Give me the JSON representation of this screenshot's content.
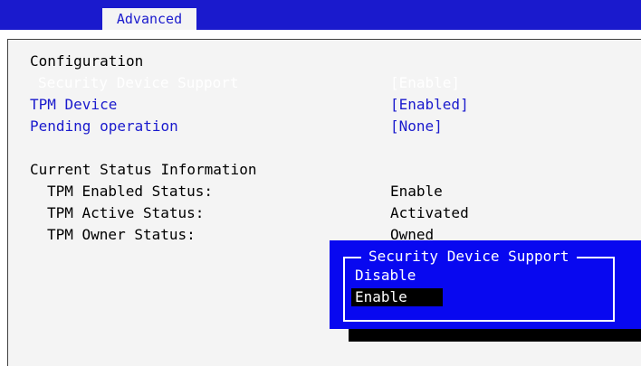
{
  "header": {
    "tab_label": "Advanced"
  },
  "main": {
    "section_configuration": "Configuration",
    "security_device_support": {
      "label": "Security Device Support",
      "value": "[Enable]"
    },
    "tpm_device": {
      "label": "TPM Device",
      "value": "[Enabled]"
    },
    "pending_operation": {
      "label": "Pending operation",
      "value": "[None]"
    },
    "section_status": "Current Status Information",
    "status_items": [
      {
        "label": "TPM Enabled Status:",
        "value": "Enable"
      },
      {
        "label": "TPM Active Status:",
        "value": "Activated"
      },
      {
        "label": "TPM Owner Status:",
        "value": "Owned"
      }
    ]
  },
  "popup": {
    "title": "Security Device Support",
    "options": [
      "Disable",
      "Enable"
    ],
    "selected": "Enable"
  },
  "colors": {
    "header_blue": "#1a1acd",
    "popup_blue": "#0808f0",
    "panel_bg": "#f4f4f4",
    "highlight": "#000000"
  }
}
